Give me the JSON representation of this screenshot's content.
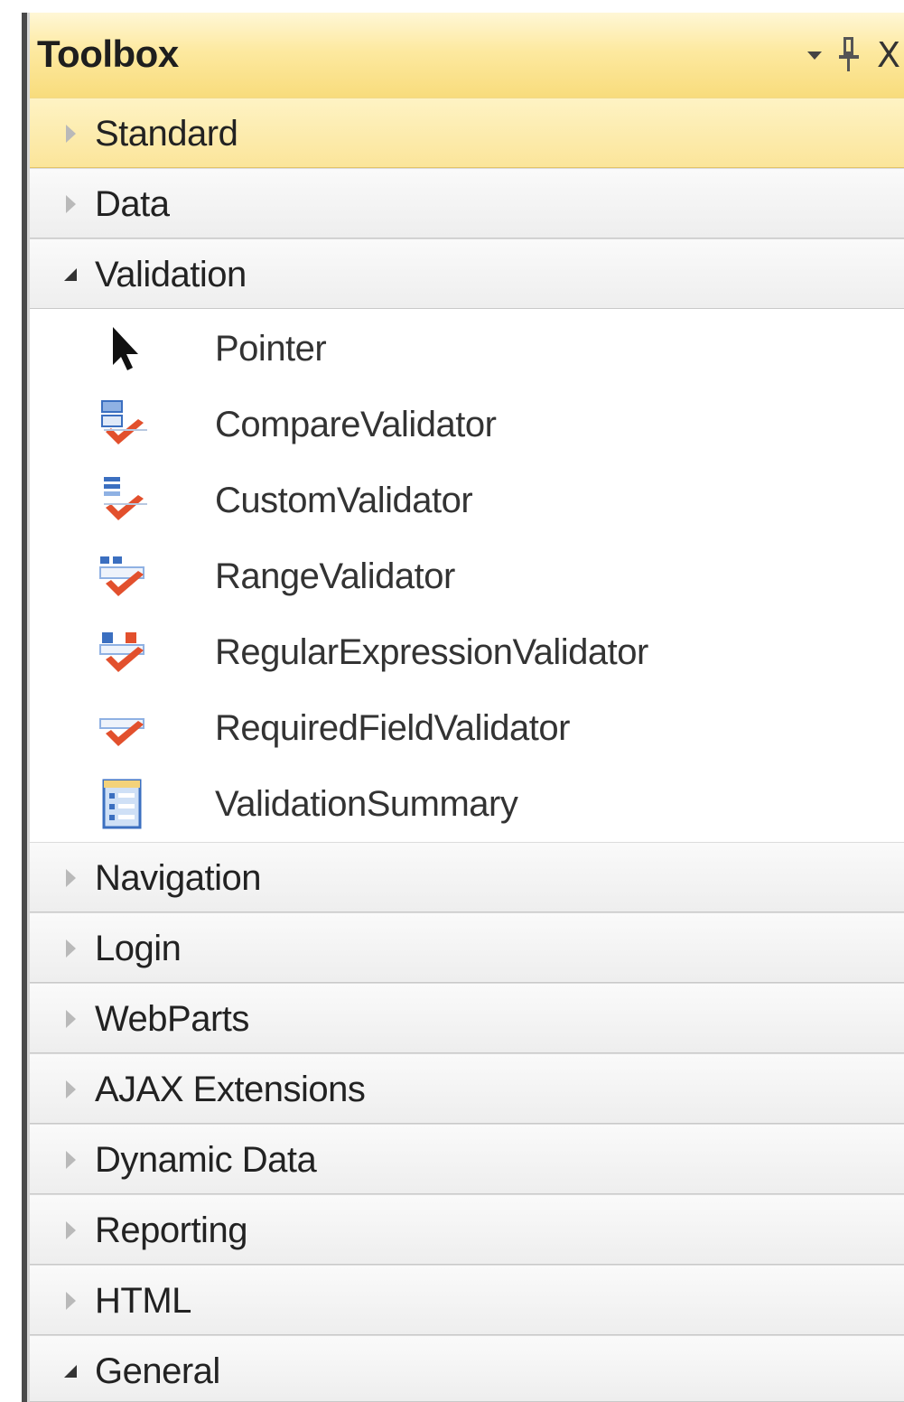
{
  "toolbox": {
    "title": "Toolbox",
    "controls": {
      "dropdown_icon": "dropdown-arrow-icon",
      "pin_icon": "pin-icon",
      "close_glyph": "X"
    },
    "sections": [
      {
        "label": "Standard",
        "state": "collapsed",
        "selected": true
      },
      {
        "label": "Data",
        "state": "collapsed"
      },
      {
        "label": "Validation",
        "state": "expanded"
      },
      {
        "label": "Navigation",
        "state": "collapsed"
      },
      {
        "label": "Login",
        "state": "collapsed"
      },
      {
        "label": "WebParts",
        "state": "collapsed"
      },
      {
        "label": "AJAX Extensions",
        "state": "collapsed"
      },
      {
        "label": "Dynamic Data",
        "state": "collapsed"
      },
      {
        "label": "Reporting",
        "state": "collapsed"
      },
      {
        "label": "HTML",
        "state": "collapsed"
      },
      {
        "label": "General",
        "state": "expanded"
      }
    ],
    "validation_items": [
      {
        "label": "Pointer",
        "icon": "pointer-arrow-icon"
      },
      {
        "label": "CompareValidator",
        "icon": "compare-validator-icon"
      },
      {
        "label": "CustomValidator",
        "icon": "custom-validator-icon"
      },
      {
        "label": "RangeValidator",
        "icon": "range-validator-icon"
      },
      {
        "label": "RegularExpressionValidator",
        "icon": "regex-validator-icon"
      },
      {
        "label": "RequiredFieldValidator",
        "icon": "required-field-validator-icon"
      },
      {
        "label": "ValidationSummary",
        "icon": "validation-summary-icon"
      }
    ]
  },
  "colors": {
    "title_bar": "#fbe59a",
    "selected_section": "#fbe59a",
    "check_red": "#e2502d",
    "icon_blue": "#3b6fc0"
  }
}
